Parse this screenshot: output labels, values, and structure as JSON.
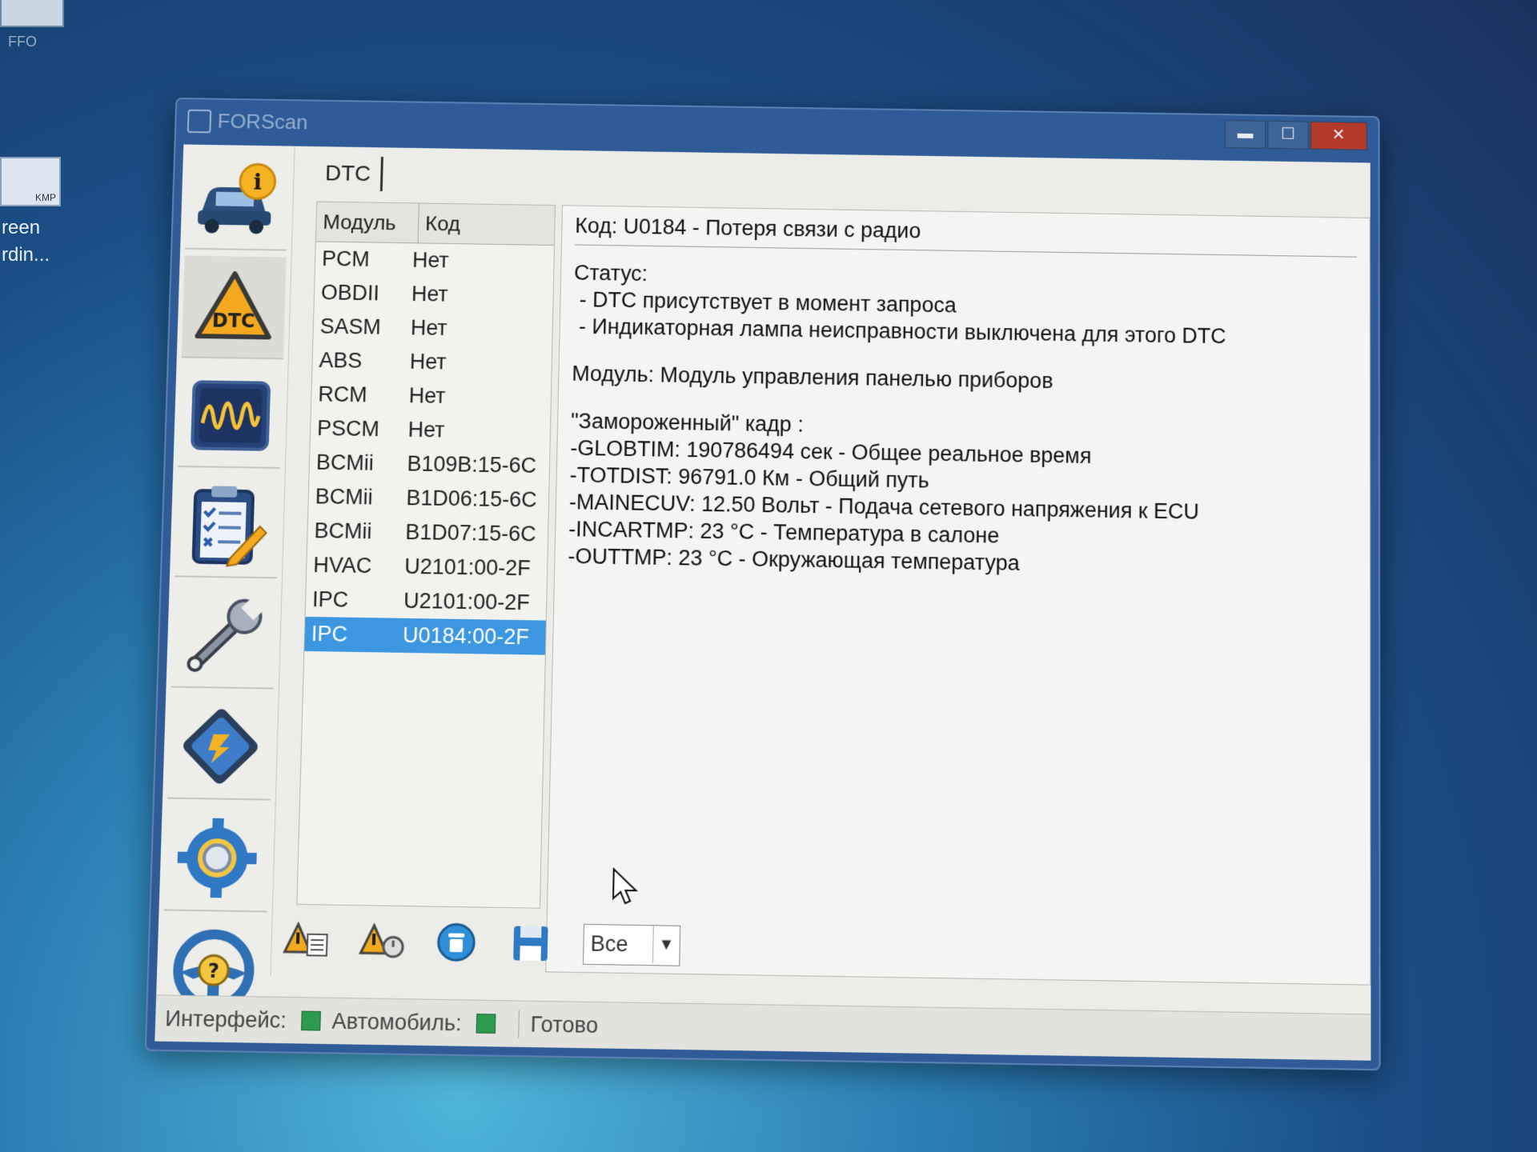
{
  "desktop": {
    "top_icon_label": "FFO",
    "file_icon_badge": "KMP",
    "label_line1": "reen",
    "label_line2": "rdin..."
  },
  "window": {
    "title": "FORScan",
    "controls": {
      "minimize": "▬",
      "maximize": "☐",
      "close": "✕"
    }
  },
  "sidebar": {
    "items": [
      {
        "name": "vehicle-info",
        "icon": "car-info-icon"
      },
      {
        "name": "dtc",
        "icon": "dtc-warning-icon",
        "label": "DTC",
        "active": true
      },
      {
        "name": "oscilloscope",
        "icon": "oscilloscope-icon"
      },
      {
        "name": "tests",
        "icon": "checklist-icon"
      },
      {
        "name": "service",
        "icon": "wrench-icon"
      },
      {
        "name": "configuration",
        "icon": "chip-icon"
      },
      {
        "name": "settings",
        "icon": "gear-icon"
      },
      {
        "name": "help",
        "icon": "steering-wheel-help-icon",
        "label": "?"
      }
    ]
  },
  "tab": {
    "label": "DTC"
  },
  "dtc_list": {
    "headers": {
      "module": "Модуль",
      "code": "Код"
    },
    "rows": [
      {
        "module": "PCM",
        "code": "Нет"
      },
      {
        "module": "OBDII",
        "code": "Нет"
      },
      {
        "module": "SASM",
        "code": "Нет"
      },
      {
        "module": "ABS",
        "code": "Нет"
      },
      {
        "module": "RCM",
        "code": "Нет"
      },
      {
        "module": "PSCM",
        "code": "Нет"
      },
      {
        "module": "BCMii",
        "code": "B109B:15-6C"
      },
      {
        "module": "BCMii",
        "code": "B1D06:15-6C"
      },
      {
        "module": "BCMii",
        "code": "B1D07:15-6C"
      },
      {
        "module": "HVAC",
        "code": "U2101:00-2F"
      },
      {
        "module": "IPC",
        "code": "U2101:00-2F"
      },
      {
        "module": "IPC",
        "code": "U0184:00-2F"
      }
    ],
    "selected_index": 11
  },
  "detail": {
    "title": "Код: U0184 - Потеря связи с радио",
    "status_header": "Статус:",
    "status_1": " - DTC присутствует в момент запроса",
    "status_2": " - Индикаторная лампа неисправности выключена для этого DTC",
    "module_line": "Модуль: Модуль управления панелью приборов",
    "freeze_header": "\"Замороженный\" кадр :",
    "freeze_1": "-GLOBTIM: 190786494 сек - Общее реальное время",
    "freeze_2": "-TOTDIST: 96791.0 Км - Общий путь",
    "freeze_3": "-MAINECUV: 12.50 Вольт - Подача сетевого напряжения к ECU",
    "freeze_4": "-INCARTMP: 23 °C - Температура в салоне",
    "freeze_5": "-OUTTMP: 23 °C - Окружающая температура"
  },
  "toolbar": {
    "buttons": [
      "read-dtc-icon",
      "clear-dtc-icon",
      "delete-icon",
      "save-icon"
    ],
    "filter_value": "Все"
  },
  "statusbar": {
    "interface_label": "Интерфейс:",
    "vehicle_label": "Автомобиль:",
    "status_text": "Готово",
    "led_color": "#2e9a4f"
  },
  "colors": {
    "selection": "#3c97e0",
    "title_bar": "#2f5c97",
    "close_button": "#b33a2a"
  }
}
